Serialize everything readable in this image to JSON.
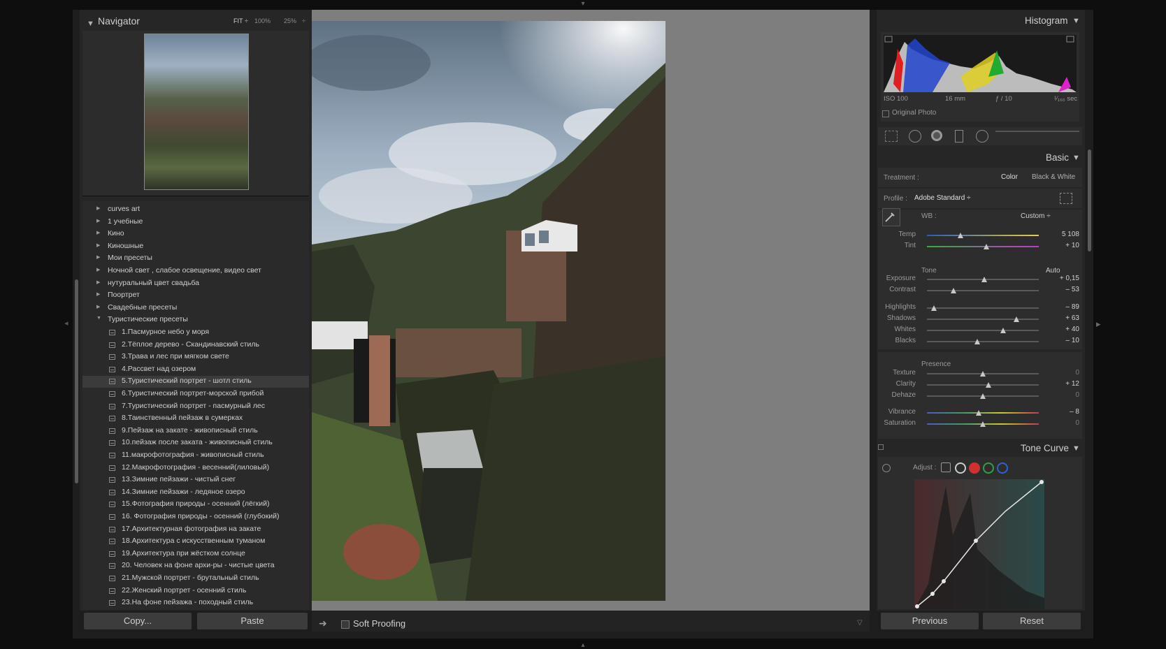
{
  "navigator": {
    "title": "Navigator",
    "zoom_options": [
      "FIT ÷",
      "100%",
      "25%",
      "÷"
    ]
  },
  "presets": {
    "folders_top": [
      "curves art",
      "1 учебные",
      "Кино",
      "Киношные",
      "Мои пресеты",
      "Ночной свет , слабое освещение, видео свет",
      "нутуральный цвет  свадьба",
      "Поортрет",
      "Свадебные пресеты"
    ],
    "open_folder": "Туристические пресеты",
    "items": [
      "1.Пасмурное небо у моря",
      "2.Тёплое дерево - Скандинавский стиль",
      "3.Трава и лес при мягком свете",
      "4.Рассвет над озером",
      "5.Туристический портрет - шотл стиль",
      "6.Туристический портрет-морской прибой",
      "7.Туристический портрет - пасмурный лес",
      "8.Таинственный пейзаж в сумерках",
      "9.Пейзаж на закате - живописный стиль",
      "10.пейзаж после заката - живописный стиль",
      "11.макрофотография - живописный стиль",
      "12.Макрофотография - весенний(лиловый)",
      "13.Зимние пейзажи - чистый снег",
      "14.Зимние пейзажи - ледяное озеро",
      "15.Фотография природы - осенний (лёгкий)",
      "16. Фотография природы - осенний (глубокий)",
      "17.Архитектурная фотография на закате",
      "18.Архитектура с искусственным туманом",
      "19.Архитектура при жёстком солнце",
      "20. Человек на фоне архи-ры - чистые цвета",
      "21.Мужской портрет - брутальный стиль",
      "22.Женский портрет - осенний стиль",
      "23.На фоне пейзажа - походный стиль"
    ],
    "selected_index": 4
  },
  "left_buttons": {
    "copy": "Copy...",
    "paste": "Paste"
  },
  "toolbar": {
    "soft_proofing": "Soft Proofing"
  },
  "histogram": {
    "title": "Histogram",
    "iso": "ISO 100",
    "focal": "16 mm",
    "aperture": "ƒ / 10",
    "shutter": "¹⁄₁₆₀ sec",
    "original_photo": "Original Photo"
  },
  "basic": {
    "title": "Basic",
    "treatment_label": "Treatment :",
    "treatment_color": "Color",
    "treatment_bw": "Black & White",
    "profile_label": "Profile :",
    "profile_value": "Adobe Standard ÷",
    "wb_label": "WB :",
    "wb_value": "Custom ÷",
    "temp": {
      "label": "Temp",
      "value": "5 108",
      "pos": 0.3
    },
    "tint": {
      "label": "Tint",
      "value": "+ 10",
      "pos": 0.53
    },
    "tone_label": "Tone",
    "auto": "Auto",
    "exposure": {
      "label": "Exposure",
      "value": "+ 0,15",
      "pos": 0.51
    },
    "contrast": {
      "label": "Contrast",
      "value": "– 53",
      "pos": 0.24
    },
    "highlights": {
      "label": "Highlights",
      "value": "– 89",
      "pos": 0.06
    },
    "shadows": {
      "label": "Shadows",
      "value": "+ 63",
      "pos": 0.8
    },
    "whites": {
      "label": "Whites",
      "value": "+ 40",
      "pos": 0.68
    },
    "blacks": {
      "label": "Blacks",
      "value": "– 10",
      "pos": 0.45
    },
    "presence_label": "Presence",
    "texture": {
      "label": "Texture",
      "value": "0",
      "pos": 0.5
    },
    "clarity": {
      "label": "Clarity",
      "value": "+ 12",
      "pos": 0.55
    },
    "dehaze": {
      "label": "Dehaze",
      "value": "0",
      "pos": 0.5
    },
    "vibrance": {
      "label": "Vibrance",
      "value": "– 8",
      "pos": 0.46
    },
    "saturation": {
      "label": "Saturation",
      "value": "0",
      "pos": 0.5
    }
  },
  "tone_curve": {
    "title": "Tone Curve",
    "adjust_label": "Adjust :"
  },
  "right_buttons": {
    "previous": "Previous",
    "reset": "Reset"
  },
  "colors": {
    "accent": "#cfcfcf",
    "panel": "#262626",
    "canvas": "#7e7e7e"
  }
}
